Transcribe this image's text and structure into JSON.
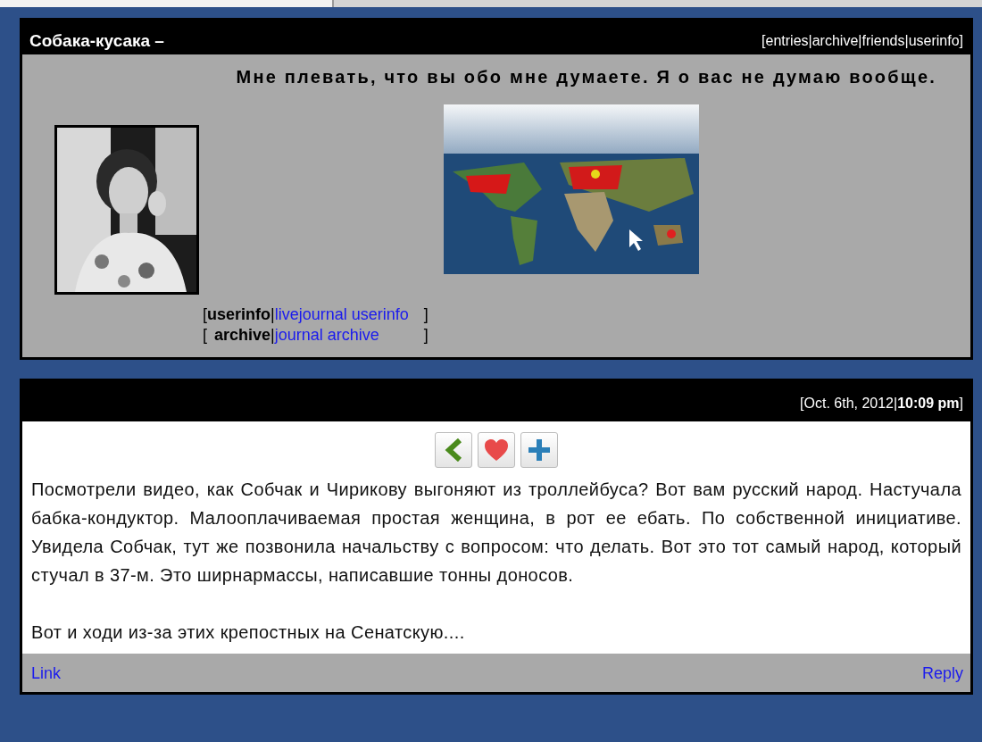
{
  "journal": {
    "title": "Собака-кусака –",
    "nav": "[entries|archive|friends|userinfo]",
    "motto": "Мне плевать, что вы обо мне думаете. Я о вас не думаю вообще.",
    "info_links": [
      {
        "open": "[",
        "label": "userinfo",
        "sep": "|",
        "link": "livejournal userinfo",
        "close": "]"
      },
      {
        "open": "[",
        "label": "archive",
        "sep": "|",
        "link": "journal archive",
        "close": "]"
      }
    ]
  },
  "entry": {
    "date": "[Oct. 6th, 2012|**10:09 pm**]",
    "actions": [
      {
        "kind": "back"
      },
      {
        "kind": "like"
      },
      {
        "kind": "add"
      }
    ],
    "paragraphs": [
      "Посмотрели видео, как Собчак и Чирикову выгоняют из троллейбуса? Вот вам русский народ. Настучала бабка-кондуктор. Малооплачиваемая простая женщина, в рот ее ебать. По собственной инициативе. Увидела Собчак, тут же позвонила начальству с вопросом: что делать. Вот это тот самый народ, который стучал в 37-м. Это ширнармассы, написавшие тонны доносов.",
      "Вот и ходи из-за этих крепостных на Сенатскую...."
    ],
    "footer_links": [
      "Link",
      "Reply"
    ]
  }
}
